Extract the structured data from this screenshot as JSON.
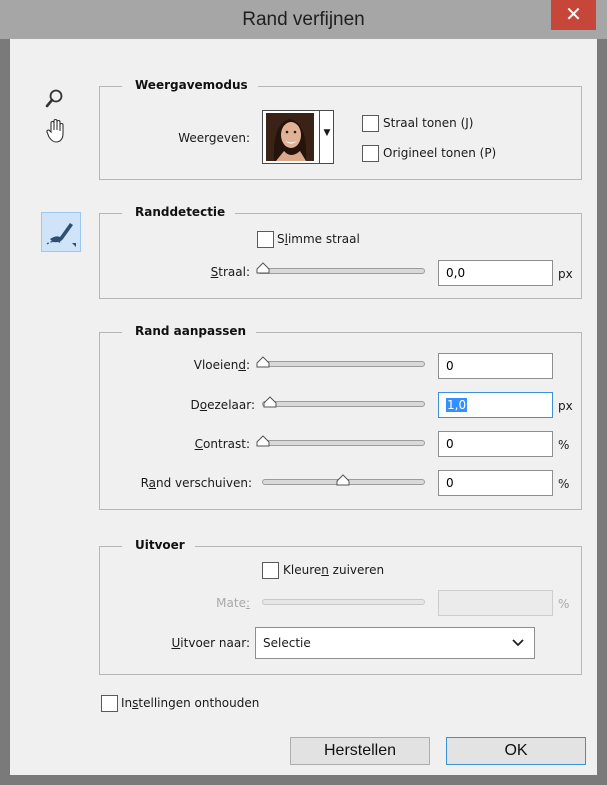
{
  "window": {
    "title": "Rand verfijnen",
    "close_glyph": "✕"
  },
  "tools": [
    "zoom-icon",
    "hand-icon",
    "refine-brush-icon"
  ],
  "view_mode": {
    "legend": "Weergavemodus",
    "view_label": "Weergeven:",
    "show_radius": {
      "label": "Straal tonen (J)",
      "checked": false
    },
    "show_original": {
      "label": "Origineel tonen (P)",
      "checked": false
    }
  },
  "edge_detection": {
    "legend": "Randdetectie",
    "smart_radius": {
      "label_pre": "S",
      "label_u": "l",
      "label_post": "imme straal",
      "checked": false
    },
    "radius": {
      "label_u": "S",
      "label_post": "traal:",
      "value": "0,0",
      "unit": "px",
      "level": 0
    }
  },
  "adjust_edge": {
    "legend": "Rand aanpassen",
    "smooth": {
      "label_pre": "Vloeien",
      "label_u": "d",
      "label_post": ":",
      "value": "0",
      "unit": "",
      "level": 0
    },
    "feather": {
      "label_pre": "D",
      "label_u": "o",
      "label_post": "ezelaar:",
      "value": "1,0",
      "unit": "px",
      "level": 0.004
    },
    "contrast": {
      "label_u": "C",
      "label_post": "ontrast:",
      "value": "0",
      "unit": "%",
      "level": 0
    },
    "shift": {
      "label_pre": "R",
      "label_u": "a",
      "label_post": "nd verschuiven:",
      "value": "0",
      "unit": "%",
      "level": 0.5
    }
  },
  "output": {
    "legend": "Uitvoer",
    "decontaminate": {
      "label_pre": "Kleure",
      "label_u": "n",
      "label_post": " zuiveren",
      "checked": false
    },
    "amount": {
      "label_pre": "Mate",
      "label_u": ":",
      "value": "",
      "unit": "%"
    },
    "output_to": {
      "label_u": "U",
      "label_post": "itvoer naar:",
      "value": "Selectie"
    }
  },
  "remember": {
    "label_pre": "In",
    "label_u": "s",
    "label_post": "tellingen onthouden",
    "checked": false
  },
  "buttons": {
    "reset": "Herstellen",
    "ok": "OK"
  },
  "colors": {
    "title_bg": "#a6a6a6",
    "close_bg": "#c7463a",
    "client_bg": "#f0f0f0",
    "focus": "#3c90d8",
    "selection": "#3390ff"
  }
}
